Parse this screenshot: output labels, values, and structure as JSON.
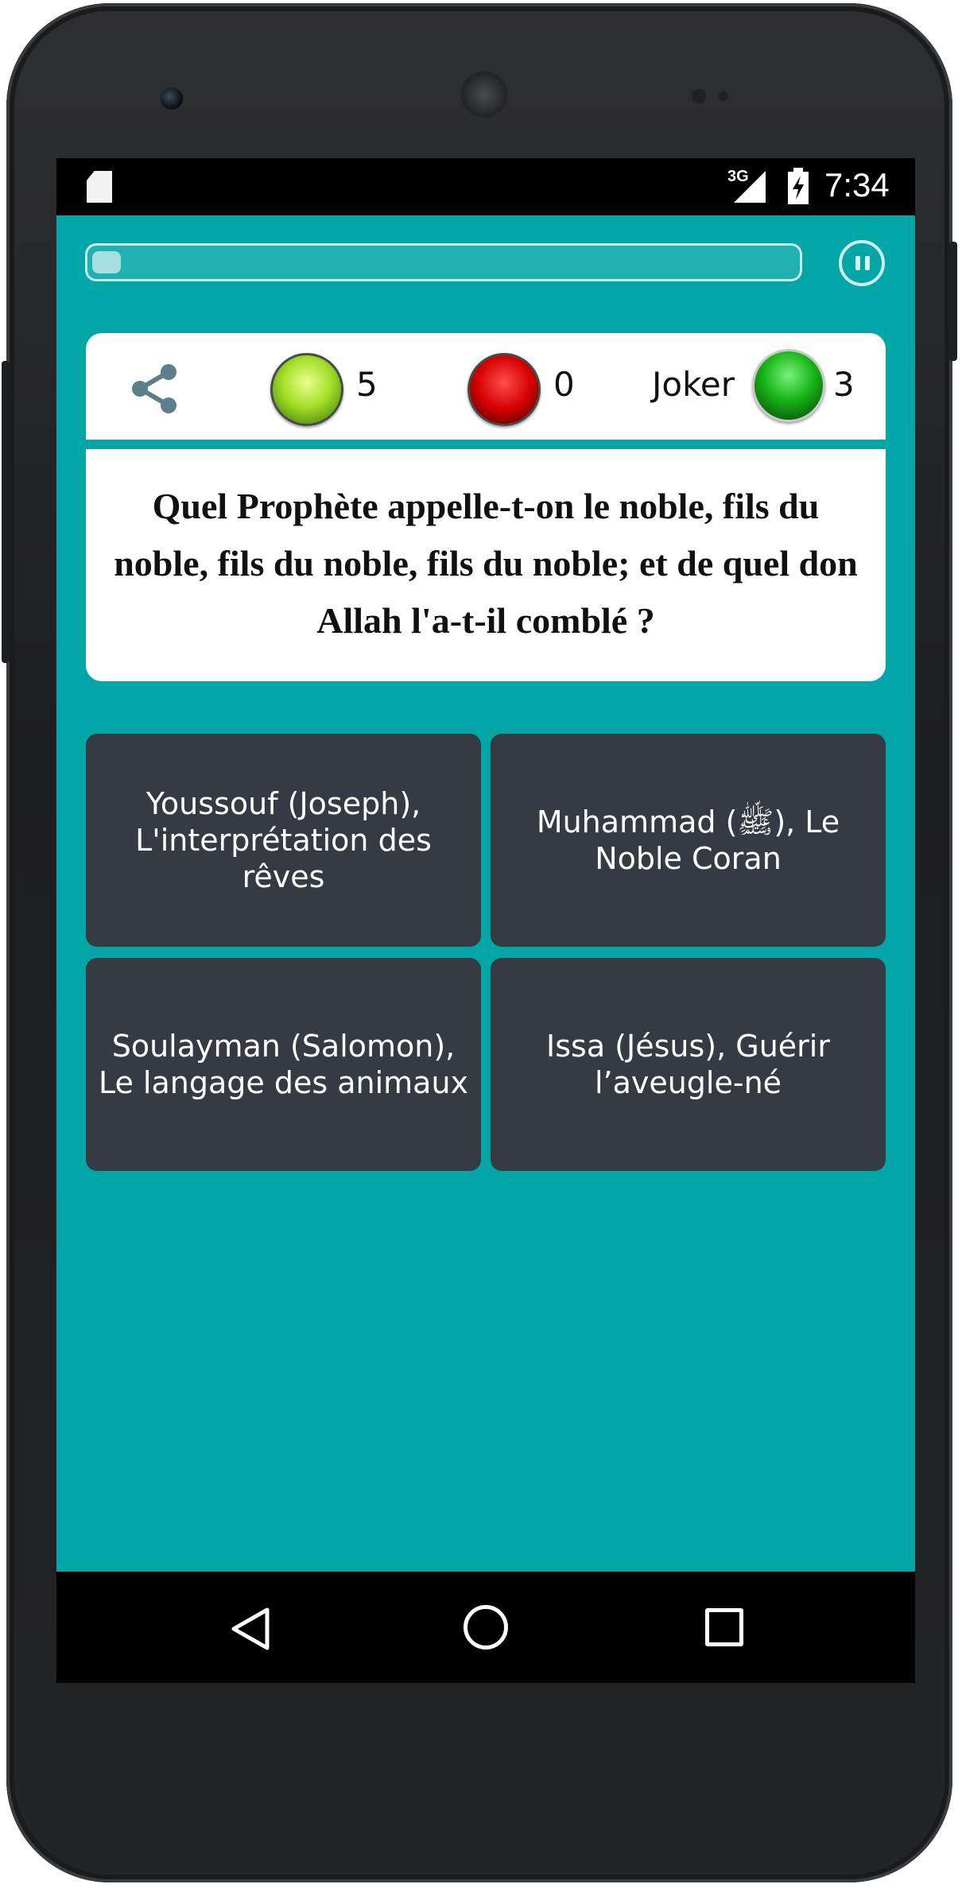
{
  "status_bar": {
    "network": "3G",
    "time": "7:34",
    "icons": [
      "sd-card-icon",
      "signal-icon",
      "battery-charging-icon"
    ]
  },
  "game": {
    "progress_fraction": 0.04,
    "pause_icon": "pause-icon"
  },
  "scores": {
    "share_icon": "share-icon",
    "correct_count": "5",
    "wrong_count": "0",
    "joker_label": "Joker",
    "joker_count": "3",
    "colors": {
      "correct": "#a6e02a",
      "wrong": "#d50000",
      "joker": "#18b418"
    }
  },
  "question": {
    "text": "Quel Prophète appelle-t-on le noble, fils du noble, fils du noble, fils du noble; et de quel don Allah l'a-t-il comblé ?"
  },
  "answers": [
    {
      "label": "Youssouf (Joseph), L'interprétation des rêves"
    },
    {
      "label": "Muhammad (ﷺ), Le Noble Coran"
    },
    {
      "label": "Soulayman (Salomon), Le langage des animaux"
    },
    {
      "label": "Issa (Jésus), Guérir l’aveugle-né"
    }
  ],
  "theme": {
    "background": "#03a6a6",
    "answer_background": "#363a42"
  },
  "nav_bar": {
    "icons": [
      "back-icon",
      "home-icon",
      "recent-apps-icon"
    ]
  }
}
